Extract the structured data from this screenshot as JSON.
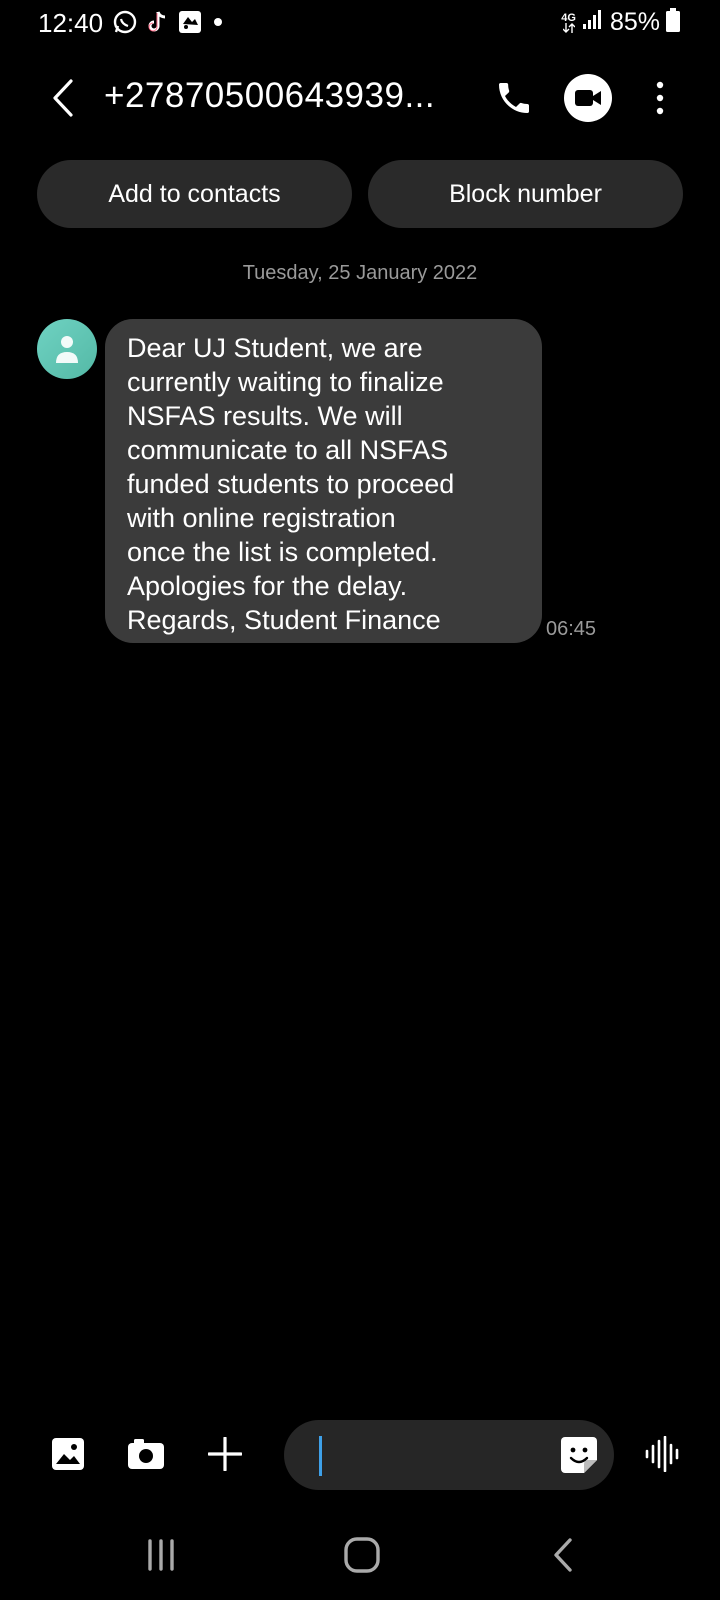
{
  "status_bar": {
    "time": "12:40",
    "network": "4G",
    "battery": "85%",
    "notification_icons": [
      "whatsapp-icon",
      "tiktok-icon",
      "app-icon",
      "dot-icon"
    ]
  },
  "header": {
    "contact": "+27870500643939...",
    "icons": [
      "back-icon",
      "phone-icon",
      "video-call-icon",
      "more-icon"
    ]
  },
  "actions": {
    "add_to_contacts": "Add to contacts",
    "block_number": "Block number"
  },
  "conversation": {
    "date": "Tuesday, 25 January 2022",
    "messages": [
      {
        "lines": [
          "Dear UJ Student, we are",
          "currently waiting to finalize",
          "NSFAS results. We will",
          "communicate to all NSFAS",
          "funded students to proceed",
          "with online registration",
          "once the list is completed.",
          "Apologies for the delay.",
          "Regards, Student Finance"
        ],
        "time": "06:45"
      }
    ]
  },
  "composer": {
    "input_value": "",
    "icons": [
      "gallery-icon",
      "camera-icon",
      "plus-icon",
      "sticker-icon",
      "voice-icon"
    ]
  },
  "navbar": {
    "icons": [
      "recents-icon",
      "home-icon",
      "back-nav-icon"
    ]
  },
  "colors": {
    "background": "#000000",
    "bubble": "#3b3b3b",
    "pill": "#2a2a2a",
    "avatar": "#5fc5b2",
    "caret": "#3ea0e8",
    "muted_text": "#9a9a9a"
  }
}
